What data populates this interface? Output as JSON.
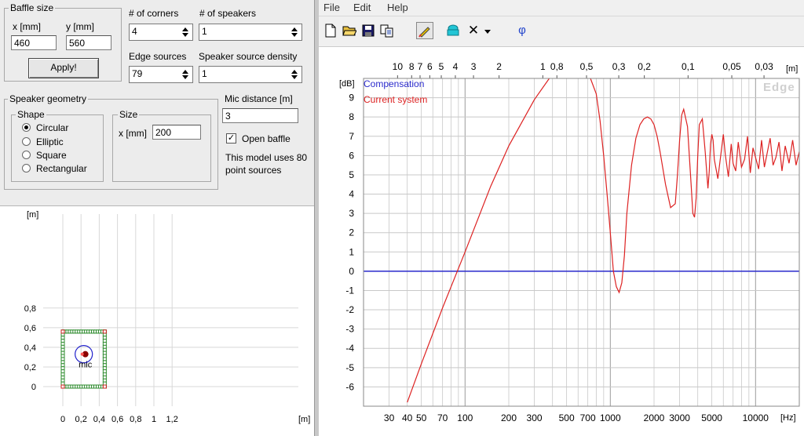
{
  "menu": {
    "file": "File",
    "edit": "Edit",
    "help": "Help"
  },
  "toolbar": {
    "icons": [
      "new-file-icon",
      "open-folder-icon",
      "save-icon",
      "copy-icon",
      "pen-icon",
      "speaker-icon",
      "delete-icon",
      "dropdown-icon",
      "phase-icon"
    ],
    "phase_label": "φ"
  },
  "baffle": {
    "title": "Baffle size",
    "x_label": "x [mm]",
    "y_label": "y [mm]",
    "x_value": "460",
    "y_value": "560",
    "apply": "Apply!"
  },
  "corners": {
    "label": "# of corners",
    "value": "4"
  },
  "speakers": {
    "label": "# of speakers",
    "value": "1"
  },
  "edge_sources": {
    "label": "Edge sources",
    "value": "79"
  },
  "source_density": {
    "label": "Speaker source density",
    "value": "1"
  },
  "geometry": {
    "title": "Speaker geometry",
    "shape_title": "Shape",
    "shapes": [
      "Circular",
      "Elliptic",
      "Square",
      "Rectangular"
    ],
    "selected": "Circular",
    "size_title": "Size",
    "size_label": "x [mm]",
    "size_value": "200"
  },
  "mic": {
    "label": "Mic distance [m]",
    "value": "3"
  },
  "open_baffle": {
    "label": "Open baffle",
    "checked": true
  },
  "model_info": {
    "line1": "This model uses 80",
    "line2": "point sources"
  },
  "baffle_plot": {
    "y_unit": "[m]",
    "x_unit": "[m]",
    "x_ticks": [
      "0",
      "0,2",
      "0,4",
      "0,6",
      "0,8",
      "1",
      "1,2"
    ],
    "y_ticks": [
      "0",
      "0,2",
      "0,4",
      "0,6",
      "0,8"
    ],
    "mic_label": "mic",
    "baffle_width_m": 0.46,
    "baffle_height_m": 0.56,
    "speaker_center_m": [
      0.23,
      0.33
    ],
    "speaker_radius_m": 0.1,
    "colors": {
      "baffle": "#2e8b2e",
      "corner": "#cc2222",
      "speaker": "#2222cc",
      "mic": "#8b0000"
    }
  },
  "chart_data": {
    "type": "line",
    "watermark": "Edge",
    "ylabel": "[dB]",
    "xlabel": "[Hz]",
    "top_unit": "[m]",
    "x_scale": "log",
    "xlim": [
      20,
      20000
    ],
    "ylim": [
      -7,
      10
    ],
    "grid": true,
    "legend_position": "top-left",
    "y_ticks": [
      9,
      8,
      7,
      6,
      5,
      4,
      3,
      2,
      1,
      0,
      -1,
      -2,
      -3,
      -4,
      -5,
      -6
    ],
    "x_ticks": [
      {
        "v": 30,
        "t": "30"
      },
      {
        "v": 40,
        "t": "40"
      },
      {
        "v": 50,
        "t": "50"
      },
      {
        "v": 70,
        "t": "70"
      },
      {
        "v": 100,
        "t": "100"
      },
      {
        "v": 200,
        "t": "200"
      },
      {
        "v": 300,
        "t": "300"
      },
      {
        "v": 500,
        "t": "500"
      },
      {
        "v": 700,
        "t": "700"
      },
      {
        "v": 1000,
        "t": "1000"
      },
      {
        "v": 2000,
        "t": "2000"
      },
      {
        "v": 3000,
        "t": "3000"
      },
      {
        "v": 5000,
        "t": "5000"
      },
      {
        "v": 10000,
        "t": "10000"
      }
    ],
    "top_ticks": [
      {
        "v": 10,
        "t": "10"
      },
      {
        "v": 8,
        "t": "8"
      },
      {
        "v": 7,
        "t": "7"
      },
      {
        "v": 6,
        "t": "6"
      },
      {
        "v": 5,
        "t": "5"
      },
      {
        "v": 4,
        "t": "4"
      },
      {
        "v": 3,
        "t": "3"
      },
      {
        "v": 2,
        "t": "2"
      },
      {
        "v": 1,
        "t": "1"
      },
      {
        "v": 0.8,
        "t": "0,8"
      },
      {
        "v": 0.5,
        "t": "0,5"
      },
      {
        "v": 0.3,
        "t": "0,3"
      },
      {
        "v": 0.2,
        "t": "0,2"
      },
      {
        "v": 0.1,
        "t": "0,1"
      },
      {
        "v": 0.05,
        "t": "0,05"
      },
      {
        "v": 0.03,
        "t": "0,03"
      }
    ],
    "series": [
      {
        "name": "Compensation",
        "color": "#2a2acc",
        "x": [
          20,
          20000
        ],
        "y": [
          0,
          0
        ]
      },
      {
        "name": "Current system",
        "color": "#dd2222",
        "x": [
          40,
          50,
          70,
          100,
          150,
          200,
          300,
          380
        ],
        "y": [
          -6.8,
          -4.8,
          -1.9,
          1.0,
          4.4,
          6.5,
          8.9,
          10
        ],
        "x2": [
          730,
          800,
          850,
          900,
          950,
          1000,
          1050,
          1100,
          1150,
          1200,
          1250,
          1300,
          1400,
          1500,
          1600,
          1700,
          1800,
          1900,
          2000,
          2100,
          2200,
          2400,
          2600,
          2800,
          2900,
          3000,
          3100,
          3200,
          3400,
          3600,
          3700,
          3800,
          3900,
          4000,
          4100,
          4300,
          4500,
          4700,
          4800,
          4900,
          5000,
          5100,
          5200,
          5500,
          5800,
          6000,
          6200,
          6500,
          6800,
          7000,
          7300,
          7600,
          8000,
          8400,
          8800,
          9200,
          9600,
          10000,
          10500,
          11000,
          11500,
          12000,
          12600,
          13200,
          13800,
          14500,
          15200,
          16000,
          17000,
          18000,
          19000,
          20000
        ],
        "y2": [
          10,
          9.2,
          7.8,
          6.0,
          4.0,
          2.0,
          0,
          -0.8,
          -1.1,
          -0.6,
          0.8,
          3.0,
          5.5,
          6.9,
          7.6,
          7.9,
          8.0,
          7.9,
          7.6,
          7.0,
          6.2,
          4.5,
          3.3,
          3.5,
          5.0,
          6.8,
          8.1,
          8.4,
          7.5,
          4.5,
          3.0,
          2.8,
          3.8,
          6.0,
          7.6,
          7.9,
          6.2,
          4.3,
          5.2,
          6.6,
          7.1,
          6.8,
          5.8,
          4.8,
          6.2,
          7.1,
          6.0,
          4.9,
          6.6,
          5.6,
          5.2,
          6.7,
          5.4,
          5.8,
          7.0,
          5.1,
          6.4,
          5.9,
          5.3,
          6.8,
          5.4,
          6.1,
          6.9,
          5.5,
          5.9,
          6.7,
          5.2,
          6.5,
          5.6,
          6.8,
          5.5,
          6.2
        ]
      }
    ]
  }
}
